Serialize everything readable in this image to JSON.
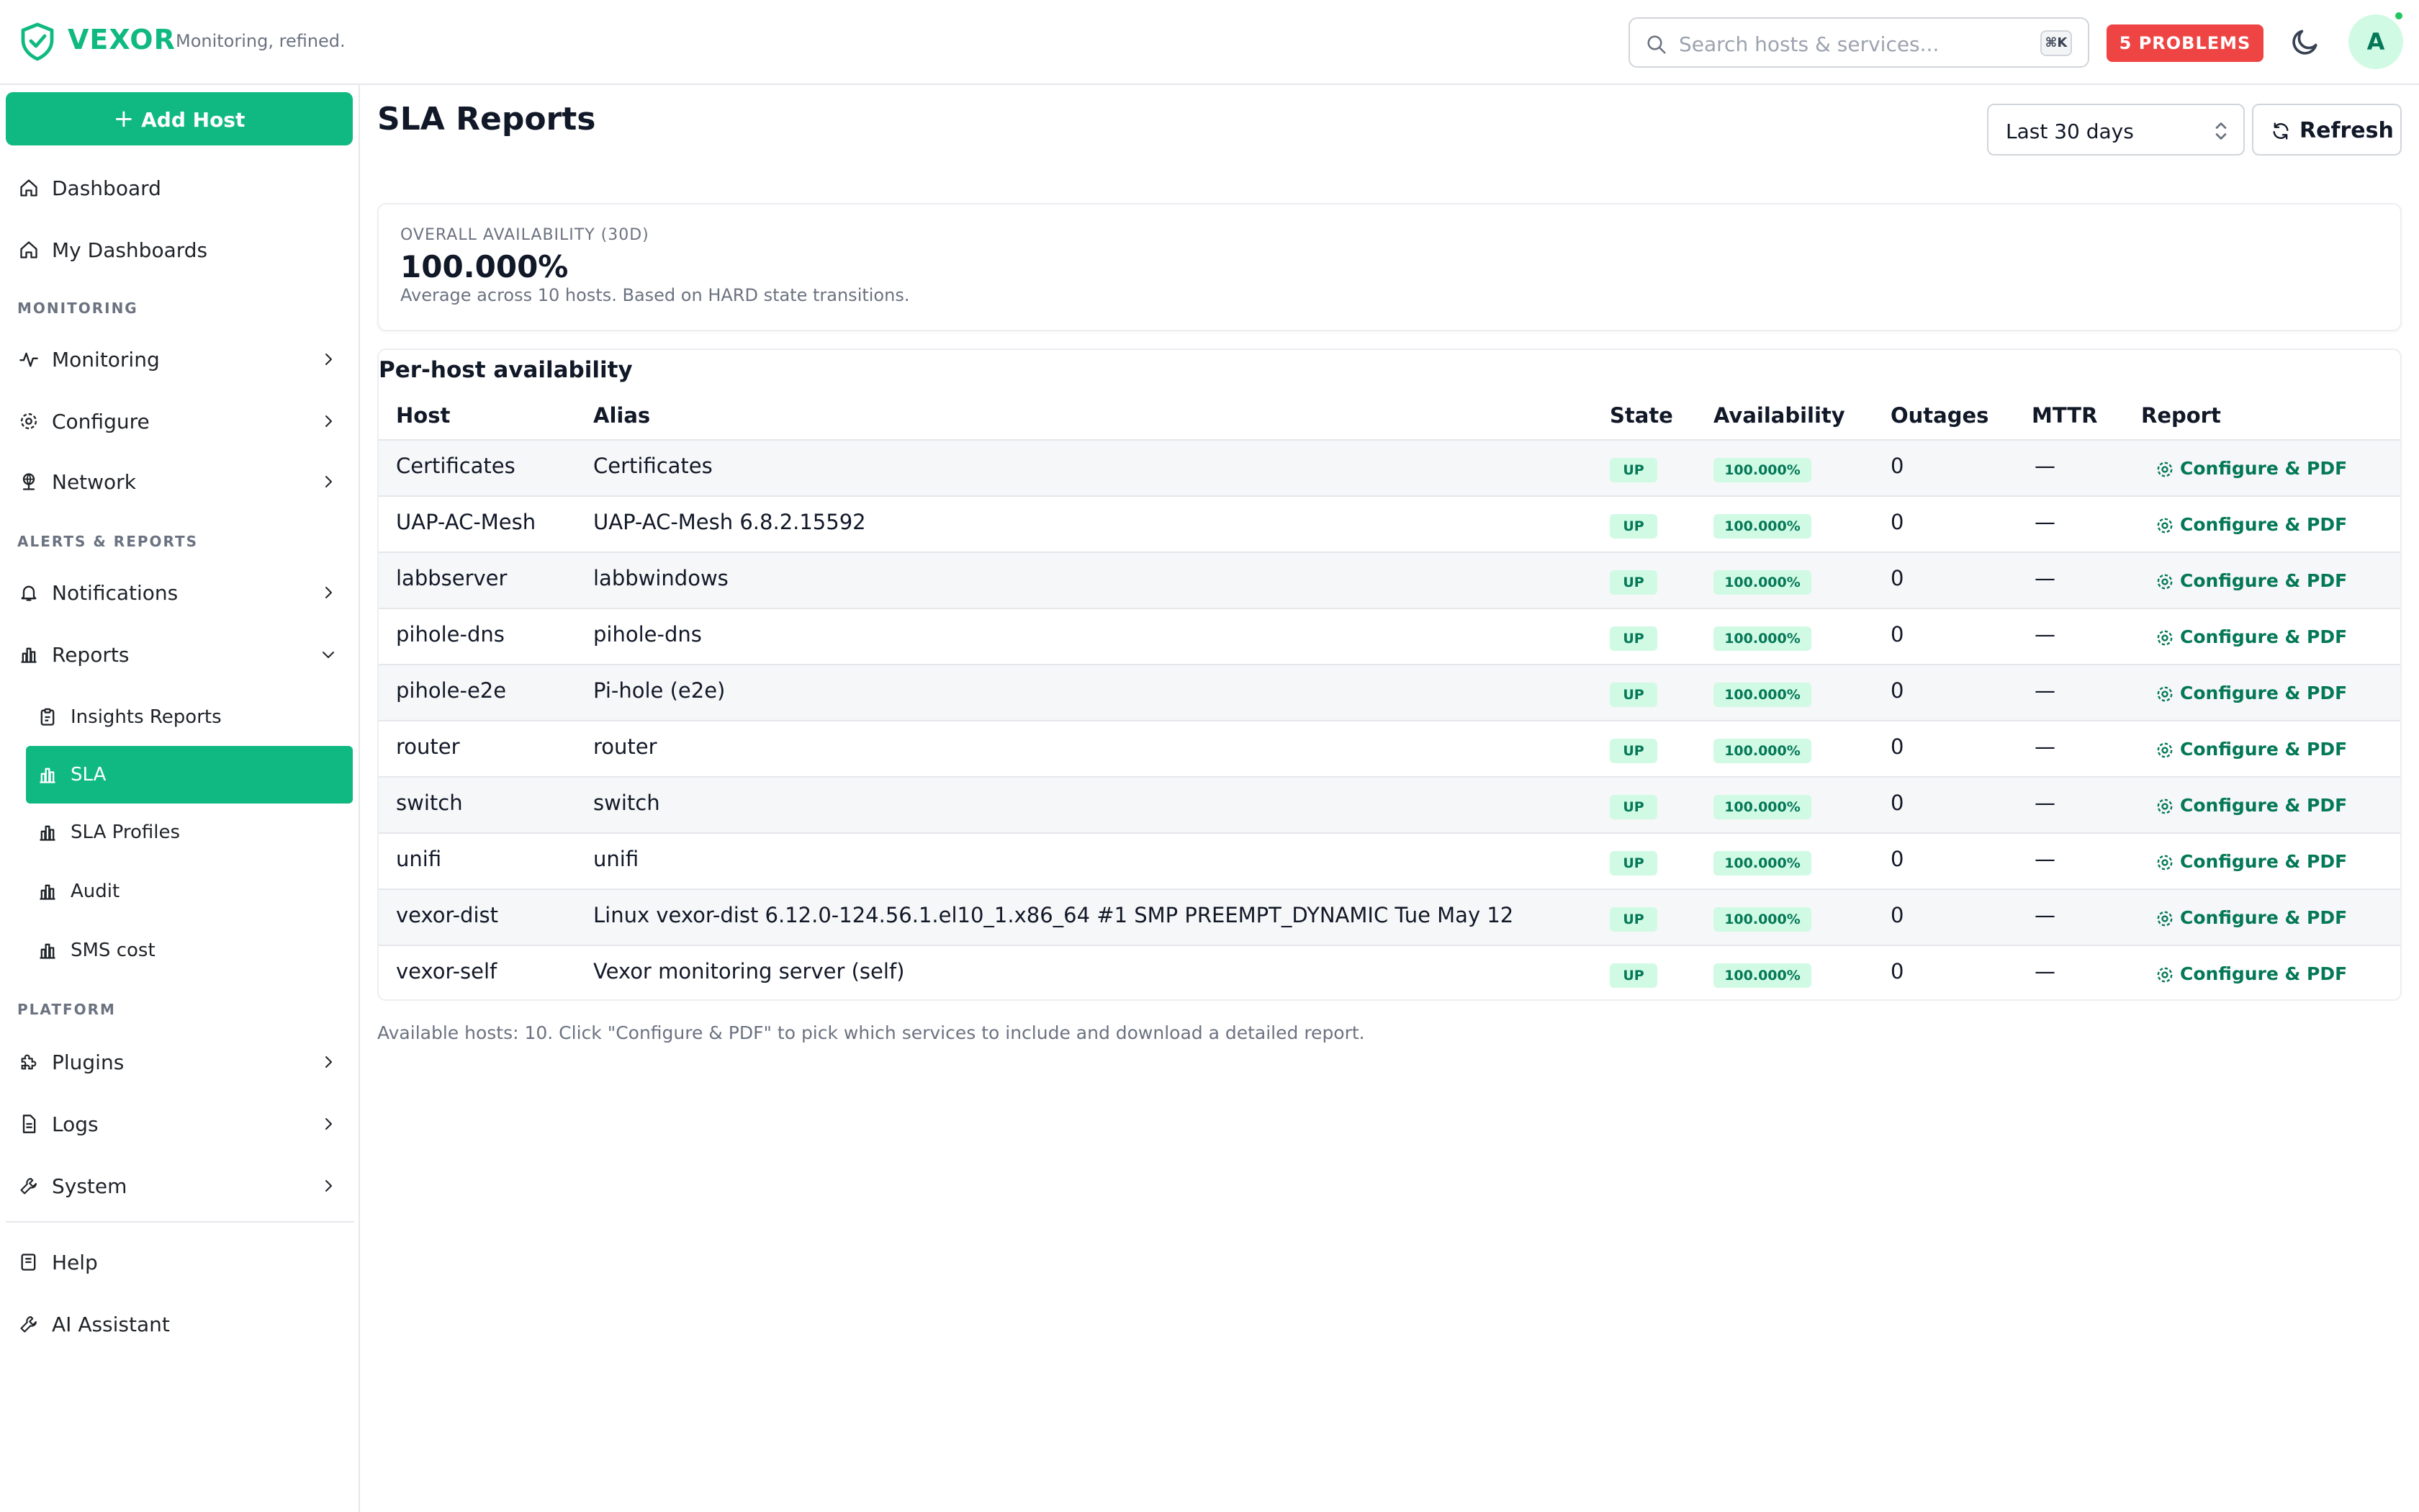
{
  "app": {
    "brand": "VEXOR",
    "tagline": "Monitoring, refined.",
    "accent_color": "#10b981",
    "danger_color": "#ef4444"
  },
  "topbar": {
    "search_placeholder": "Search hosts & services...",
    "search_shortcut": "⌘K",
    "problems_label": "5 PROBLEMS",
    "theme_icon": "moon-icon",
    "avatar_initial": "A"
  },
  "sidebar": {
    "add_host_label": "Add Host",
    "top_items": [
      {
        "label": "Dashboard",
        "icon": "home-icon"
      },
      {
        "label": "My Dashboards",
        "icon": "home-icon"
      }
    ],
    "sections": {
      "monitoring": "MONITORING",
      "alerts_reports": "ALERTS & REPORTS",
      "platform": "PLATFORM"
    },
    "monitoring_items": [
      {
        "label": "Monitoring",
        "icon": "activity-icon"
      },
      {
        "label": "Configure",
        "icon": "gear-icon"
      },
      {
        "label": "Network",
        "icon": "network-icon"
      }
    ],
    "alerts_items": [
      {
        "label": "Notifications",
        "icon": "bell-icon"
      },
      {
        "label": "Reports",
        "icon": "bar-chart-icon"
      }
    ],
    "report_sub_items": [
      {
        "label": "Insights Reports",
        "icon": "clipboard-icon",
        "active": false
      },
      {
        "label": "SLA",
        "icon": "bar-chart-icon",
        "active": true
      },
      {
        "label": "SLA Profiles",
        "icon": "bar-chart-icon",
        "active": false
      },
      {
        "label": "Audit",
        "icon": "bar-chart-icon",
        "active": false
      },
      {
        "label": "SMS cost",
        "icon": "bar-chart-icon",
        "active": false
      }
    ],
    "platform_items": [
      {
        "label": "Plugins",
        "icon": "puzzle-icon"
      },
      {
        "label": "Logs",
        "icon": "file-icon"
      },
      {
        "label": "System",
        "icon": "wrench-icon"
      }
    ],
    "bottom_items": [
      {
        "label": "Help",
        "icon": "book-icon"
      },
      {
        "label": "AI Assistant",
        "icon": "wrench-icon"
      }
    ]
  },
  "main": {
    "title": "SLA Reports",
    "range_value": "Last 30 days",
    "refresh_label": "Refresh",
    "summary": {
      "label": "OVERALL AVAILABILITY (30D)",
      "value": "100.000%",
      "note": "Average across 10 hosts. Based on HARD state transitions."
    },
    "table": {
      "title": "Per-host availability",
      "columns": [
        "Host",
        "Alias",
        "State",
        "Availability",
        "Outages",
        "MTTR",
        "Report"
      ],
      "rows": [
        {
          "host": "Certificates",
          "alias": "Certificates",
          "state": "UP",
          "availability": "100.000%",
          "outages": "0",
          "mttr": "—",
          "report": "Configure & PDF"
        },
        {
          "host": "UAP-AC-Mesh",
          "alias": "UAP-AC-Mesh 6.8.2.15592",
          "state": "UP",
          "availability": "100.000%",
          "outages": "0",
          "mttr": "—",
          "report": "Configure & PDF"
        },
        {
          "host": "labbserver",
          "alias": "labbwindows",
          "state": "UP",
          "availability": "100.000%",
          "outages": "0",
          "mttr": "—",
          "report": "Configure & PDF"
        },
        {
          "host": "pihole-dns",
          "alias": "pihole-dns",
          "state": "UP",
          "availability": "100.000%",
          "outages": "0",
          "mttr": "—",
          "report": "Configure & PDF"
        },
        {
          "host": "pihole-e2e",
          "alias": "Pi-hole (e2e)",
          "state": "UP",
          "availability": "100.000%",
          "outages": "0",
          "mttr": "—",
          "report": "Configure & PDF"
        },
        {
          "host": "router",
          "alias": "router",
          "state": "UP",
          "availability": "100.000%",
          "outages": "0",
          "mttr": "—",
          "report": "Configure & PDF"
        },
        {
          "host": "switch",
          "alias": "switch",
          "state": "UP",
          "availability": "100.000%",
          "outages": "0",
          "mttr": "—",
          "report": "Configure & PDF"
        },
        {
          "host": "unifi",
          "alias": "unifi",
          "state": "UP",
          "availability": "100.000%",
          "outages": "0",
          "mttr": "—",
          "report": "Configure & PDF"
        },
        {
          "host": "vexor-dist",
          "alias": "Linux vexor-dist 6.12.0-124.56.1.el10_1.x86_64 #1 SMP PREEMPT_DYNAMIC Tue May 12",
          "state": "UP",
          "availability": "100.000%",
          "outages": "0",
          "mttr": "—",
          "report": "Configure & PDF"
        },
        {
          "host": "vexor-self",
          "alias": "Vexor monitoring server (self)",
          "state": "UP",
          "availability": "100.000%",
          "outages": "0",
          "mttr": "—",
          "report": "Configure & PDF"
        }
      ]
    },
    "footnote": "Available hosts: 10. Click \"Configure & PDF\" to pick which services to include and download a detailed report."
  }
}
